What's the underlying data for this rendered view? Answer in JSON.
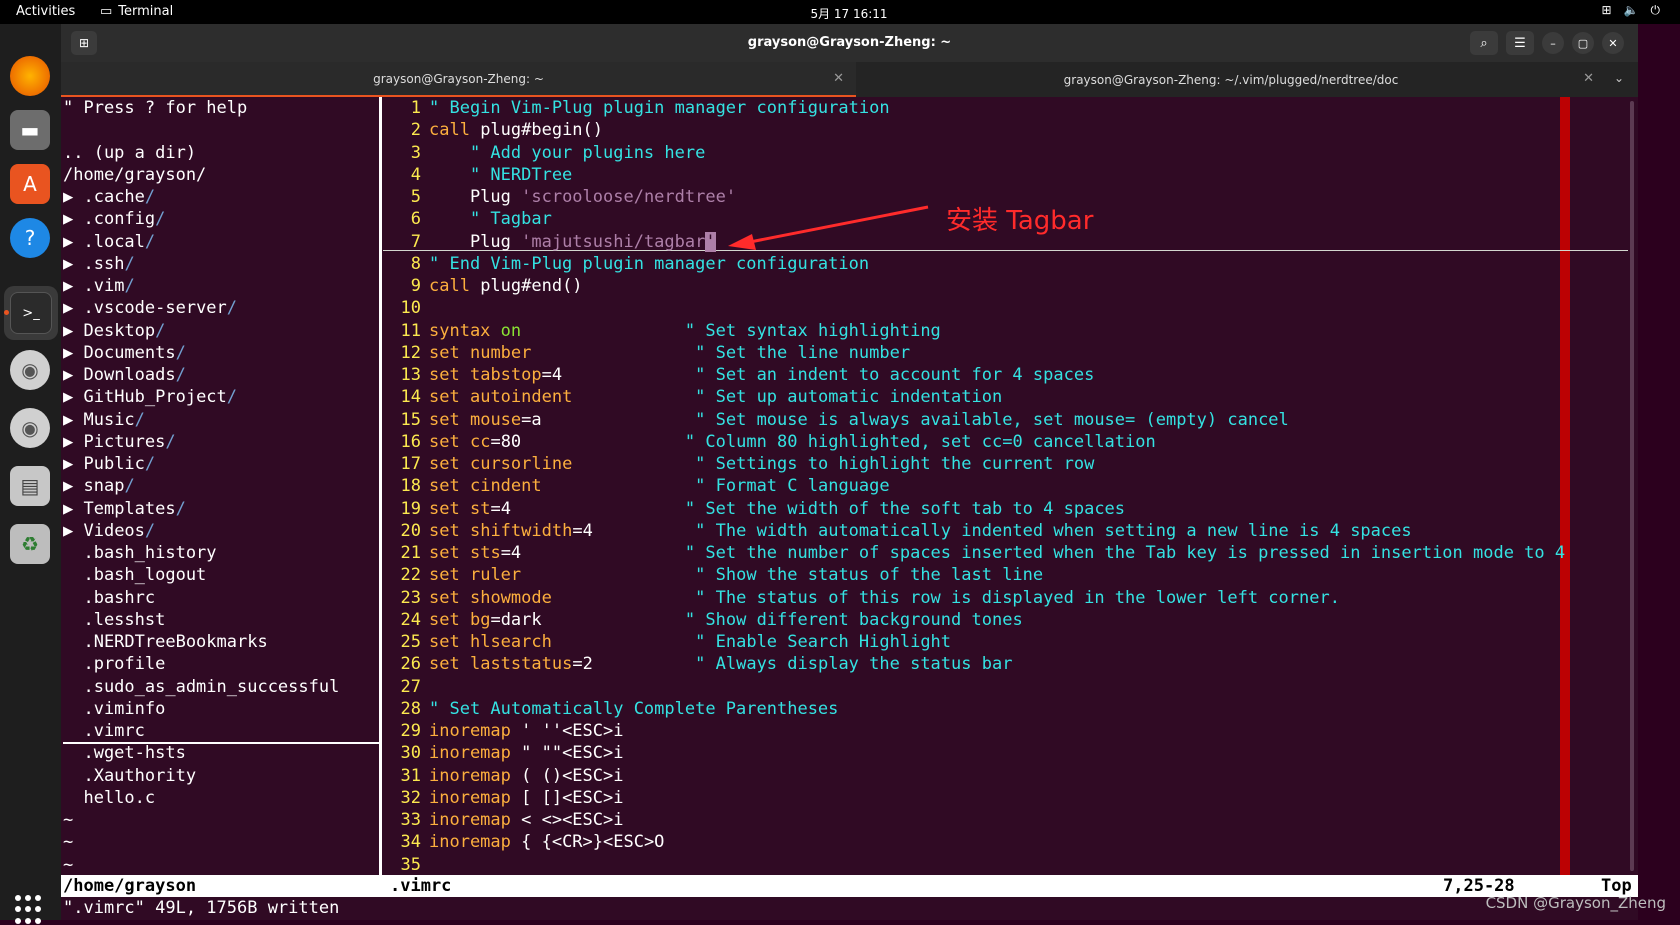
{
  "topbar": {
    "activities": "Activities",
    "app": "Terminal",
    "clock": "5月 17  16:11"
  },
  "window": {
    "title": "grayson@Grayson-Zheng: ~",
    "tabs": [
      {
        "label": "grayson@Grayson-Zheng: ~",
        "active": true
      },
      {
        "label": "grayson@Grayson-Zheng: ~/.vim/plugged/nerdtree/doc",
        "active": false
      }
    ]
  },
  "tree": {
    "help": "\" Press ? for help",
    "lines": [
      "",
      ".. (up a dir)",
      "/home/grayson/",
      "▶ .cache/",
      "▶ .config/",
      "▶ .local/",
      "▶ .ssh/",
      "▶ .vim/",
      "▶ .vscode-server/",
      "▶ Desktop/",
      "▶ Documents/",
      "▶ Downloads/",
      "▶ GitHub_Project/",
      "▶ Music/",
      "▶ Pictures/",
      "▶ Public/",
      "▶ snap/",
      "▶ Templates/",
      "▶ Videos/",
      "  .bash_history",
      "  .bash_logout",
      "  .bashrc",
      "  .lesshst",
      "  .NERDTreeBookmarks",
      "  .profile",
      "  .sudo_as_admin_successful",
      "  .viminfo",
      "  .vimrc",
      "  .wget-hsts",
      "  .Xauthority",
      "  hello.c",
      "~",
      "~",
      "~"
    ]
  },
  "editor": {
    "lines": [
      [
        {
          "t": "\" Begin Vim-Plug plugin manager configuration",
          "c": "c-comment"
        }
      ],
      [
        {
          "t": "call",
          "c": "c-kw"
        },
        {
          "t": " plug#begin()",
          "c": ""
        }
      ],
      [
        {
          "t": "    \" Add your plugins here",
          "c": "c-comment"
        }
      ],
      [
        {
          "t": "    \" NERDTree",
          "c": "c-comment"
        }
      ],
      [
        {
          "t": "    Plug ",
          "c": ""
        },
        {
          "t": "'scrooloose/nerdtree'",
          "c": "c-str"
        }
      ],
      [
        {
          "t": "    \" Tagbar",
          "c": "c-comment"
        }
      ],
      [
        {
          "t": "    Plug ",
          "c": ""
        },
        {
          "t": "'majutsushi/tagbar",
          "c": "c-str"
        },
        {
          "t": "'",
          "c": "cur"
        }
      ],
      [
        {
          "t": "\" End Vim-Plug plugin manager configuration",
          "c": "c-comment"
        }
      ],
      [
        {
          "t": "call",
          "c": "c-kw"
        },
        {
          "t": " plug#end()",
          "c": ""
        }
      ],
      [
        {
          "t": "",
          "c": ""
        }
      ],
      [
        {
          "t": "syntax",
          "c": "c-kw"
        },
        {
          "t": " ",
          "c": ""
        },
        {
          "t": "on",
          "c": "c-on"
        },
        {
          "t": "                ",
          "c": ""
        },
        {
          "t": "\" Set syntax highlighting",
          "c": "c-comment"
        }
      ],
      [
        {
          "t": "set",
          "c": "c-kw"
        },
        {
          "t": " ",
          "c": ""
        },
        {
          "t": "number",
          "c": "c-kw"
        },
        {
          "t": "                ",
          "c": ""
        },
        {
          "t": "\" Set the line number",
          "c": "c-comment"
        }
      ],
      [
        {
          "t": "set",
          "c": "c-kw"
        },
        {
          "t": " ",
          "c": ""
        },
        {
          "t": "tabstop",
          "c": "c-kw"
        },
        {
          "t": "=4             ",
          "c": ""
        },
        {
          "t": "\" Set an indent to account for 4 spaces",
          "c": "c-comment"
        }
      ],
      [
        {
          "t": "set",
          "c": "c-kw"
        },
        {
          "t": " ",
          "c": ""
        },
        {
          "t": "autoindent",
          "c": "c-kw"
        },
        {
          "t": "            ",
          "c": ""
        },
        {
          "t": "\" Set up automatic indentation",
          "c": "c-comment"
        }
      ],
      [
        {
          "t": "set",
          "c": "c-kw"
        },
        {
          "t": " ",
          "c": ""
        },
        {
          "t": "mouse",
          "c": "c-kw"
        },
        {
          "t": "=a               ",
          "c": ""
        },
        {
          "t": "\" Set mouse is always available, set mouse= (empty) cancel",
          "c": "c-comment"
        }
      ],
      [
        {
          "t": "set",
          "c": "c-kw"
        },
        {
          "t": " ",
          "c": ""
        },
        {
          "t": "cc",
          "c": "c-kw"
        },
        {
          "t": "=80                ",
          "c": ""
        },
        {
          "t": "\" Column 80 highlighted, set cc=0 cancellation",
          "c": "c-comment"
        }
      ],
      [
        {
          "t": "set",
          "c": "c-kw"
        },
        {
          "t": " ",
          "c": ""
        },
        {
          "t": "cursorline",
          "c": "c-kw"
        },
        {
          "t": "            ",
          "c": ""
        },
        {
          "t": "\" Settings to highlight the current row",
          "c": "c-comment"
        }
      ],
      [
        {
          "t": "set",
          "c": "c-kw"
        },
        {
          "t": " ",
          "c": ""
        },
        {
          "t": "cindent",
          "c": "c-kw"
        },
        {
          "t": "               ",
          "c": ""
        },
        {
          "t": "\" Format C language",
          "c": "c-comment"
        }
      ],
      [
        {
          "t": "set",
          "c": "c-kw"
        },
        {
          "t": " ",
          "c": ""
        },
        {
          "t": "st",
          "c": "c-kw"
        },
        {
          "t": "=4                 ",
          "c": ""
        },
        {
          "t": "\" Set the width of the soft tab to 4 spaces",
          "c": "c-comment"
        }
      ],
      [
        {
          "t": "set",
          "c": "c-kw"
        },
        {
          "t": " ",
          "c": ""
        },
        {
          "t": "shiftwidth",
          "c": "c-kw"
        },
        {
          "t": "=4          ",
          "c": ""
        },
        {
          "t": "\" The width automatically indented when setting a new line is 4 spaces",
          "c": "c-comment"
        }
      ],
      [
        {
          "t": "set",
          "c": "c-kw"
        },
        {
          "t": " ",
          "c": ""
        },
        {
          "t": "sts",
          "c": "c-kw"
        },
        {
          "t": "=4                ",
          "c": ""
        },
        {
          "t": "\" Set the number of spaces inserted when the Tab key is pressed in insertion mode to 4",
          "c": "c-comment"
        }
      ],
      [
        {
          "t": "set",
          "c": "c-kw"
        },
        {
          "t": " ",
          "c": ""
        },
        {
          "t": "ruler",
          "c": "c-kw"
        },
        {
          "t": "                 ",
          "c": ""
        },
        {
          "t": "\" Show the status of the last line",
          "c": "c-comment"
        }
      ],
      [
        {
          "t": "set",
          "c": "c-kw"
        },
        {
          "t": " ",
          "c": ""
        },
        {
          "t": "showmode",
          "c": "c-kw"
        },
        {
          "t": "              ",
          "c": ""
        },
        {
          "t": "\" The status of this row is displayed in the lower left corner.",
          "c": "c-comment"
        }
      ],
      [
        {
          "t": "set",
          "c": "c-kw"
        },
        {
          "t": " ",
          "c": ""
        },
        {
          "t": "bg",
          "c": "c-kw"
        },
        {
          "t": "=dark              ",
          "c": ""
        },
        {
          "t": "\" Show different background tones",
          "c": "c-comment"
        }
      ],
      [
        {
          "t": "set",
          "c": "c-kw"
        },
        {
          "t": " ",
          "c": ""
        },
        {
          "t": "hlsearch",
          "c": "c-kw"
        },
        {
          "t": "              ",
          "c": ""
        },
        {
          "t": "\" Enable Search Highlight",
          "c": "c-comment"
        }
      ],
      [
        {
          "t": "set",
          "c": "c-kw"
        },
        {
          "t": " ",
          "c": ""
        },
        {
          "t": "laststatus",
          "c": "c-kw"
        },
        {
          "t": "=2          ",
          "c": ""
        },
        {
          "t": "\" Always display the status bar",
          "c": "c-comment"
        }
      ],
      [
        {
          "t": "",
          "c": ""
        }
      ],
      [
        {
          "t": "\" Set Automatically Complete Parentheses",
          "c": "c-comment"
        }
      ],
      [
        {
          "t": "inoremap",
          "c": "c-kw"
        },
        {
          "t": " ' ''<ESC>i",
          "c": ""
        }
      ],
      [
        {
          "t": "inoremap",
          "c": "c-kw"
        },
        {
          "t": " \" \"\"<ESC>i",
          "c": ""
        }
      ],
      [
        {
          "t": "inoremap",
          "c": "c-kw"
        },
        {
          "t": " ( ()<ESC>i",
          "c": ""
        }
      ],
      [
        {
          "t": "inoremap",
          "c": "c-kw"
        },
        {
          "t": " [ []<ESC>i",
          "c": ""
        }
      ],
      [
        {
          "t": "inoremap",
          "c": "c-kw"
        },
        {
          "t": " < <><ESC>i",
          "c": ""
        }
      ],
      [
        {
          "t": "inoremap",
          "c": "c-kw"
        },
        {
          "t": " { {<CR>}<ESC>O",
          "c": ""
        }
      ],
      [
        {
          "t": "",
          "c": ""
        }
      ]
    ]
  },
  "status": {
    "left": "/home/grayson",
    "file": ".vimrc",
    "pos": "7,25-28",
    "scroll": "Top"
  },
  "message": "\".vimrc\" 49L, 1756B written",
  "annotation": "安装 Tagbar",
  "watermark": "CSDN @Grayson_Zheng"
}
